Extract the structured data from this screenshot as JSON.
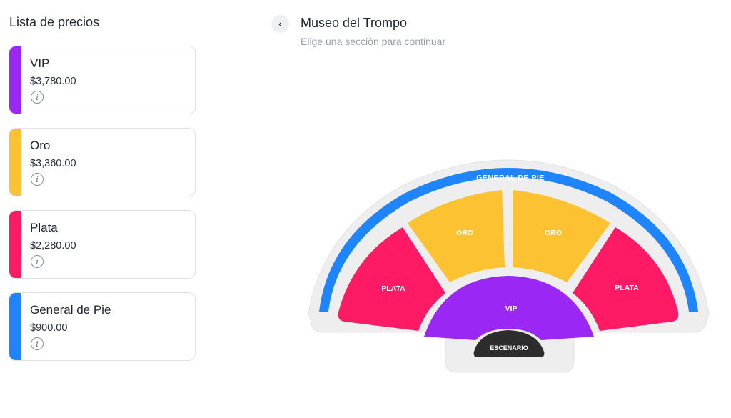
{
  "sidebar": {
    "title": "Lista de precios",
    "items": [
      {
        "name": "VIP",
        "price": "$3,780.00",
        "color": "#9b27f5"
      },
      {
        "name": "Oro",
        "price": "$3,360.00",
        "color": "#fcc232"
      },
      {
        "name": "Plata",
        "price": "$2,280.00",
        "color": "#ff1a66"
      },
      {
        "name": "General de Pie",
        "price": "$900.00",
        "color": "#1f85ff"
      }
    ],
    "info_icon": "info-icon"
  },
  "header": {
    "back_icon": "chevron-left-icon",
    "title": "Museo del Trompo",
    "subtitle": "Elige una sección para continuar"
  },
  "map": {
    "general_label": "GENERAL DE PIE",
    "oro_left_label": "ORO",
    "oro_right_label": "ORO",
    "plata_left_label": "PLATA",
    "plata_right_label": "PLATA",
    "vip_label": "VIP",
    "stage_label": "ESCENARIO",
    "colors": {
      "vip": "#9b27f5",
      "oro": "#fcc232",
      "plata": "#ff1a66",
      "general": "#1f85ff",
      "stage": "#2d2d2d",
      "base": "#eeeeee"
    }
  }
}
